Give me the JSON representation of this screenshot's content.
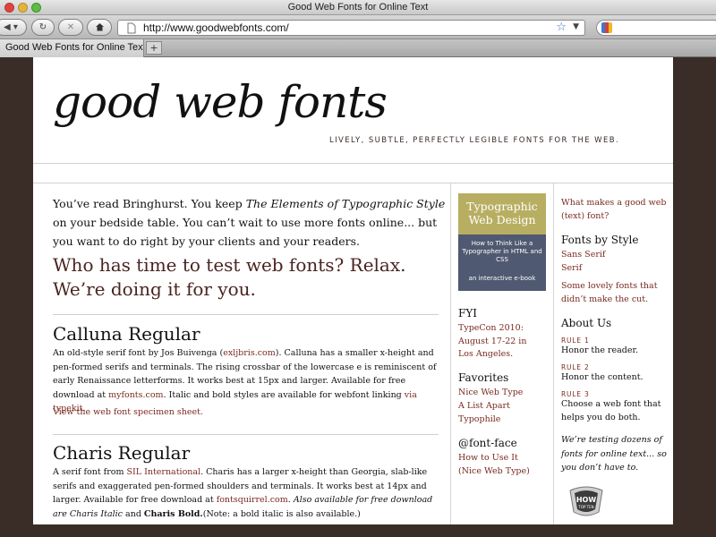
{
  "browser": {
    "window_title": "Good Web Fonts for Online Text",
    "url": "http://www.goodwebfonts.com/",
    "tab_label": "Good Web Fonts for Online Text",
    "new_tab_label": "+",
    "back_icon": "back-arrow-icon",
    "forward_icon": "forward-arrow-icon",
    "stop_label": "✕",
    "home_icon": "home-icon"
  },
  "header": {
    "logo": "good web fonts",
    "tagline": "LIVELY, SUBTLE, PERFECTLY LEGIBLE FONTS FOR THE WEB."
  },
  "main": {
    "intro_a": "You’ve read Bringhurst. You keep ",
    "intro_book": "The Elements of Typographic Style",
    "intro_b": " on your bedside table. You can’t wait to use more fonts online... but you want to do right by your clients and your readers.",
    "pitch": "Who has time to test web fonts? Relax. We’re doing it for you.",
    "fonts": [
      {
        "name": "Calluna Regular",
        "d1": "An old-style serif font by Jos Buivenga (",
        "d1_link": "exljbris.com",
        "d2": "). Calluna has a smaller x-height and pen-formed serifs and terminals. The rising crossbar of the lowercase e is reminiscent of early Renaissance letterforms. It works best at 15px and larger. Available for free download at ",
        "d2_link": "myfonts.com",
        "d3": ". Italic and bold styles are available for webfont linking ",
        "d3_link": "via typekit",
        "d4": ".",
        "specimen": "View the web font specimen sheet."
      },
      {
        "name": "Charis Regular",
        "d1": "A serif font from ",
        "d1_link": "SIL International",
        "d2": ". Charis has a larger x-height than Georgia, slab-like serifs and exaggerated pen-formed shoulders and terminals. It works best at 14px and larger. Available for free download at ",
        "d2_link": "fontsquirrel.com",
        "d3": ". ",
        "d3_italic": "Also available for free download are Charis Italic",
        "d4": " and ",
        "d4_bold": "Charis Bold.",
        "d5": "(Note: a bold italic is also available.)"
      }
    ]
  },
  "middle": {
    "book_title": "Typographic Web Design",
    "book_subtitle": "How to Think Like a Typographer in HTML and CSS",
    "book_footer": "an interactive e-book",
    "fyi_heading": "FYI",
    "fyi_link": "TypeCon 2010: August 17-22 in Los Angeles.",
    "favorites_heading": "Favorites",
    "favorites": [
      "Nice Web Type",
      "A List Apart",
      "Typophile"
    ],
    "fontface_heading": "@font-face",
    "fontface_links": [
      "How to Use It",
      "(Nice Web Type)"
    ]
  },
  "right": {
    "good_font_link": "What makes a good web (text) font?",
    "by_style_heading": "Fonts by Style",
    "styles": [
      "Sans Serif",
      "Serif"
    ],
    "lovely_link": "Some lovely fonts that didn’t make the cut.",
    "about_heading": "About Us",
    "rules": [
      {
        "label": "RULE 1",
        "text": "Honor the reader."
      },
      {
        "label": "RULE 2",
        "text": "Honor the content."
      },
      {
        "label": "RULE 3",
        "text": "Choose a web font that helps you do both."
      }
    ],
    "testing_note": "We’re testing dozens of fonts for online text... so you don’t have to.",
    "badge_top": "HOW",
    "badge_bottom": "TOP TEN"
  },
  "colors": {
    "background": "#3a2c27",
    "link": "#7a2a20",
    "book_top": "#b8ae62",
    "book_bottom": "#4f5971"
  }
}
